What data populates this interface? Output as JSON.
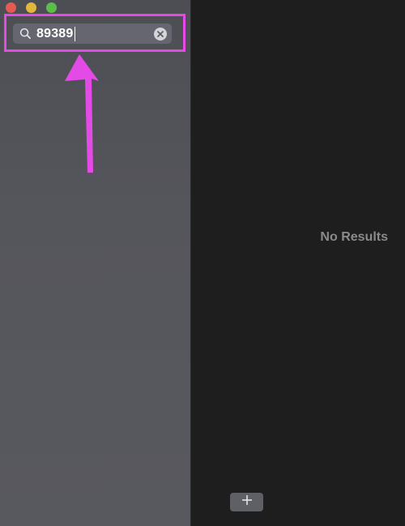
{
  "window": {
    "controls": [
      "close",
      "minimize",
      "zoom"
    ]
  },
  "sidebar": {
    "search": {
      "value": "89389",
      "icon": "search-icon",
      "clear_icon": "clear-icon",
      "has_focus": true
    }
  },
  "annotation": {
    "color": "#e44ae6",
    "shape": "highlight-box-with-arrow"
  },
  "main": {
    "empty_state_label": "No Results",
    "add_button_icon": "plus-icon"
  },
  "colors": {
    "sidebar_bg": "#55565c",
    "main_bg": "#1e1e1f",
    "annotation": "#e44ae6",
    "close": "#e55a52",
    "minimize": "#e3b73c",
    "zoom": "#5cbe48"
  }
}
